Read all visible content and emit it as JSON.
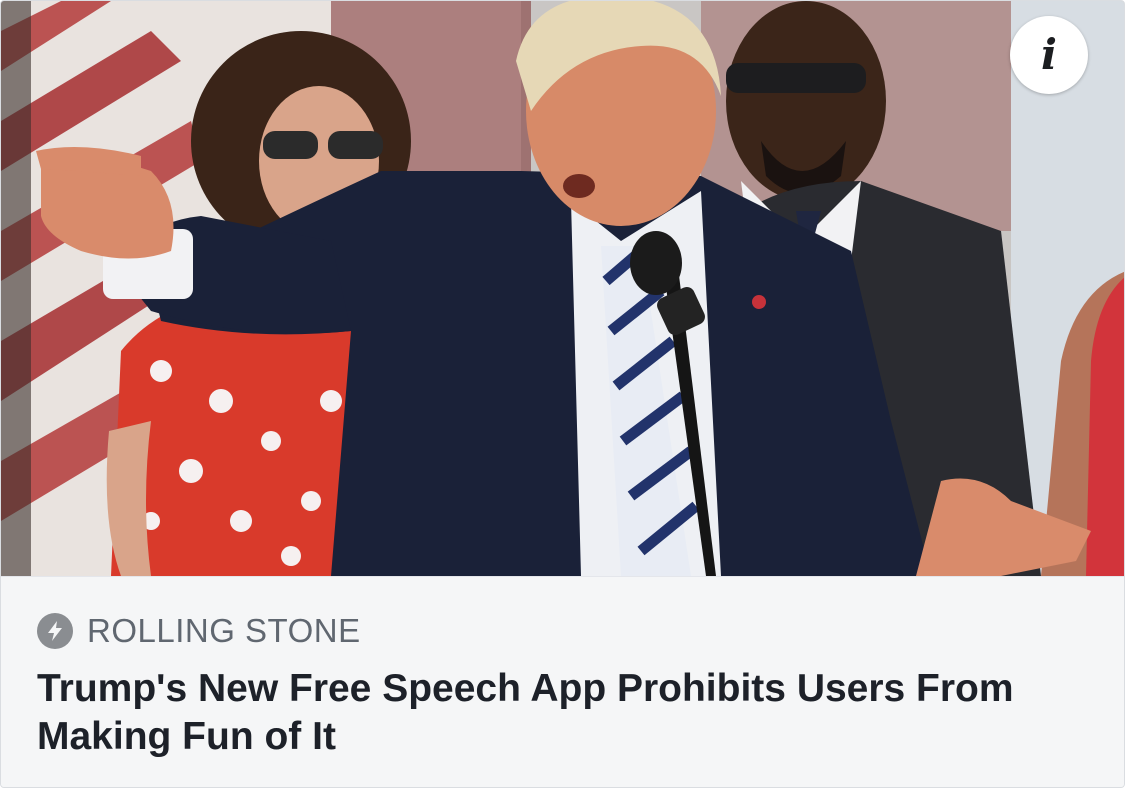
{
  "link_preview": {
    "source": {
      "name": "ROLLING STONE",
      "icon": "lightning-bolt-icon"
    },
    "headline": "Trump's New Free Speech App Prohibits Users From Making Fun of It",
    "info_button": {
      "icon": "info-icon",
      "glyph": "i"
    },
    "image": {
      "description_icon": "press-photo"
    }
  },
  "colors": {
    "card_background": "#f5f6f7",
    "source_text": "#606770",
    "headline_text": "#1d2129",
    "source_icon": "#8a8d91"
  }
}
